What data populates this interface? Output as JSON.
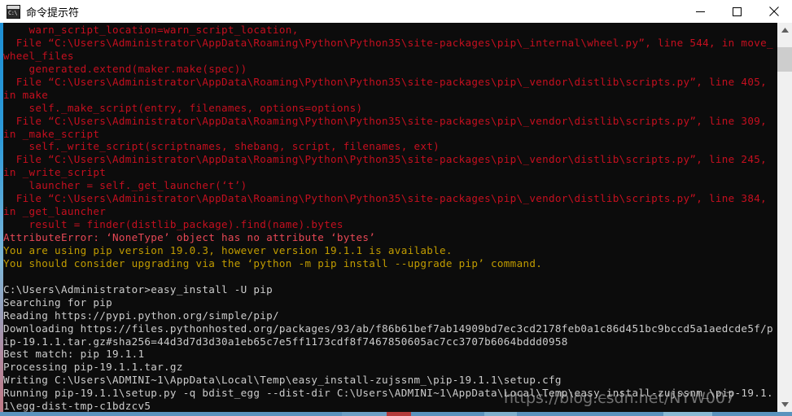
{
  "window": {
    "title": "命令提示符",
    "icon": "console-icon",
    "controls": [
      {
        "name": "minimize-button",
        "label": "–"
      },
      {
        "name": "maximize-button",
        "label": "□"
      },
      {
        "name": "close-button",
        "label": "✕"
      }
    ]
  },
  "colors": {
    "titlebar_bg": "#ffffff",
    "console_bg": "#0c0c0c",
    "text_default": "#cccccc",
    "text_error": "#c50f1f",
    "text_error_bright": "#e74856",
    "text_warning": "#c19c00",
    "active_border": "#2e9ad8",
    "scrollbar_track": "#f0f0f0",
    "scrollbar_thumb": "#cdcdcd"
  },
  "console": {
    "lines": [
      {
        "color": "red",
        "text": "    warn_script_location=warn_script_location,"
      },
      {
        "color": "red",
        "text": "  File “C:\\Users\\Administrator\\AppData\\Roaming\\Python\\Python35\\site-packages\\pip\\_internal\\wheel.py”, line 544, in move_"
      },
      {
        "color": "red",
        "text": "wheel_files"
      },
      {
        "color": "red",
        "text": "    generated.extend(maker.make(spec))"
      },
      {
        "color": "red",
        "text": "  File “C:\\Users\\Administrator\\AppData\\Roaming\\Python\\Python35\\site-packages\\pip\\_vendor\\distlib\\scripts.py”, line 405,"
      },
      {
        "color": "red",
        "text": "in make"
      },
      {
        "color": "red",
        "text": "    self._make_script(entry, filenames, options=options)"
      },
      {
        "color": "red",
        "text": "  File “C:\\Users\\Administrator\\AppData\\Roaming\\Python\\Python35\\site-packages\\pip\\_vendor\\distlib\\scripts.py”, line 309,"
      },
      {
        "color": "red",
        "text": "in _make_script"
      },
      {
        "color": "red",
        "text": "    self._write_script(scriptnames, shebang, script, filenames, ext)"
      },
      {
        "color": "red",
        "text": "  File “C:\\Users\\Administrator\\AppData\\Roaming\\Python\\Python35\\site-packages\\pip\\_vendor\\distlib\\scripts.py”, line 245,"
      },
      {
        "color": "red",
        "text": "in _write_script"
      },
      {
        "color": "red",
        "text": "    launcher = self._get_launcher(‘t’)"
      },
      {
        "color": "red",
        "text": "  File “C:\\Users\\Administrator\\AppData\\Roaming\\Python\\Python35\\site-packages\\pip\\_vendor\\distlib\\scripts.py”, line 384,"
      },
      {
        "color": "red",
        "text": "in _get_launcher"
      },
      {
        "color": "red",
        "text": "    result = finder(distlib_package).find(name).bytes"
      },
      {
        "color": "brred",
        "text": "AttributeError: ‘NoneType’ object has no attribute ‘bytes’"
      },
      {
        "color": "yellow",
        "text": "You are using pip version 19.0.3, however version 19.1.1 is available."
      },
      {
        "color": "yellow",
        "text": "You should consider upgrading via the ‘python -m pip install --upgrade pip’ command."
      },
      {
        "color": "white",
        "text": ""
      },
      {
        "color": "white",
        "text": "C:\\Users\\Administrator>easy_install -U pip"
      },
      {
        "color": "white",
        "text": "Searching for pip"
      },
      {
        "color": "white",
        "text": "Reading https://pypi.python.org/simple/pip/"
      },
      {
        "color": "white",
        "text": "Downloading https://files.pythonhosted.org/packages/93/ab/f86b61bef7ab14909bd7ec3cd2178feb0a1c86d451bc9bccd5a1aedcde5f/p"
      },
      {
        "color": "white",
        "text": "ip-19.1.1.tar.gz#sha256=44d3d7d3d30a1eb65c7e5ff1173cdf8f7467850605ac7cc3707b6064bddd0958"
      },
      {
        "color": "white",
        "text": "Best match: pip 19.1.1"
      },
      {
        "color": "white",
        "text": "Processing pip-19.1.1.tar.gz"
      },
      {
        "color": "white",
        "text": "Writing C:\\Users\\ADMINI~1\\AppData\\Local\\Temp\\easy_install-zujssnm_\\pip-19.1.1\\setup.cfg"
      },
      {
        "color": "white",
        "text": "Running pip-19.1.1\\setup.py -q bdist_egg --dist-dir C:\\Users\\ADMINI~1\\AppData\\Local\\Temp\\easy_install-zujssnm_\\pip-19.1."
      },
      {
        "color": "white",
        "text": "1\\egg-dist-tmp-c1bdzcv5"
      }
    ]
  },
  "scrollbar": {
    "up_arrow": "▲",
    "down_arrow": "▼"
  },
  "watermark": {
    "text": "https://blog.csdn.net/NYW007"
  }
}
